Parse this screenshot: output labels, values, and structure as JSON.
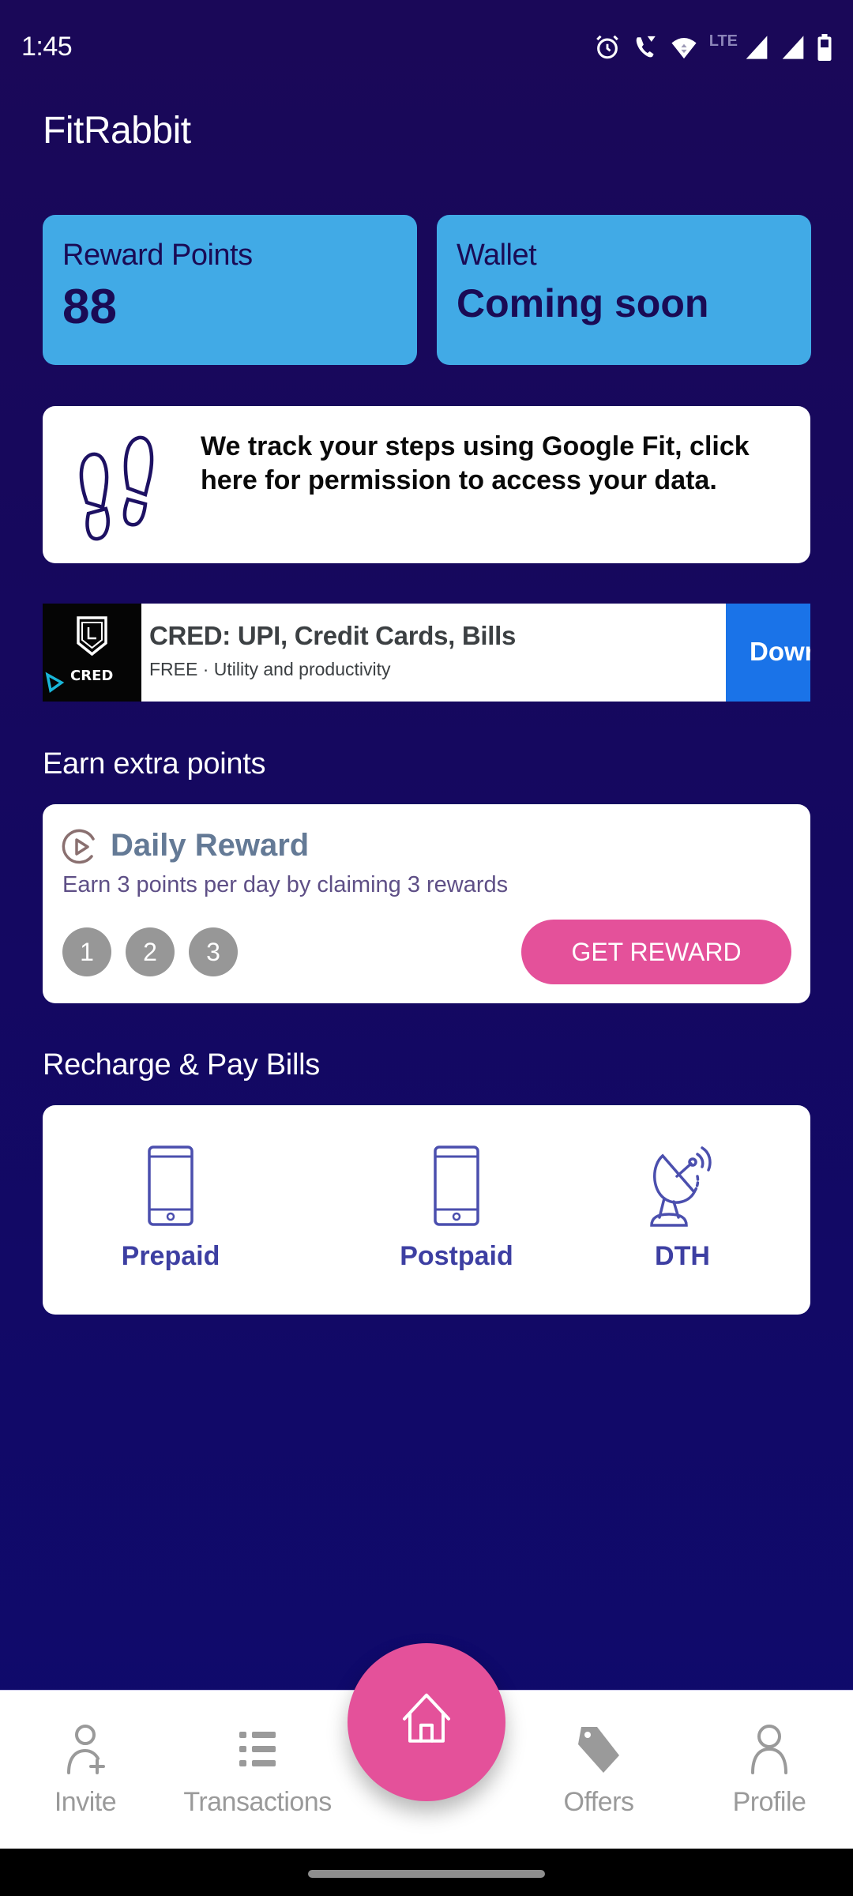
{
  "status_bar": {
    "time": "1:45",
    "network_label": "LTE",
    "icons": [
      "alarm-icon",
      "wifi-calling-icon",
      "wifi-icon",
      "signal-icon",
      "signal-icon",
      "battery-icon"
    ]
  },
  "app": {
    "title": "FitRabbit"
  },
  "stats": {
    "reward_points": {
      "label": "Reward Points",
      "value": "88"
    },
    "wallet": {
      "label": "Wallet",
      "value": "Coming soon"
    }
  },
  "google_fit": {
    "icon": "footprints-icon",
    "message": "We track your steps using Google Fit, click here for permission to access your data."
  },
  "ad": {
    "brand": "CRED",
    "title": "CRED: UPI, Credit Cards, Bills",
    "subtitle": "FREE · Utility and productivity",
    "button_label": "Download"
  },
  "earn_section": {
    "title": "Earn extra points",
    "daily_reward": {
      "icon": "play-circle-icon",
      "title": "Daily Reward",
      "subtitle": "Earn 3 points per day by claiming 3 rewards",
      "steps": [
        "1",
        "2",
        "3"
      ],
      "button_label": "GET REWARD"
    }
  },
  "recharge_section": {
    "title": "Recharge & Pay Bills",
    "items": [
      {
        "label": "Prepaid",
        "icon": "smartphone-icon"
      },
      {
        "label": "Postpaid",
        "icon": "smartphone-icon"
      },
      {
        "label": "DTH",
        "icon": "satellite-dish-icon"
      }
    ]
  },
  "bottom_nav": {
    "items": [
      {
        "label": "Invite",
        "icon": "add-user-icon"
      },
      {
        "label": "Transactions",
        "icon": "list-icon"
      },
      {
        "label": "Offers",
        "icon": "tag-icon"
      },
      {
        "label": "Profile",
        "icon": "user-icon"
      }
    ],
    "home": {
      "icon": "home-icon"
    }
  },
  "colors": {
    "background": "#15085f",
    "card_blue": "#41aae6",
    "accent_pink": "#e4519a",
    "recharge_text": "#3d3fa2",
    "ad_button": "#1a73e8"
  }
}
